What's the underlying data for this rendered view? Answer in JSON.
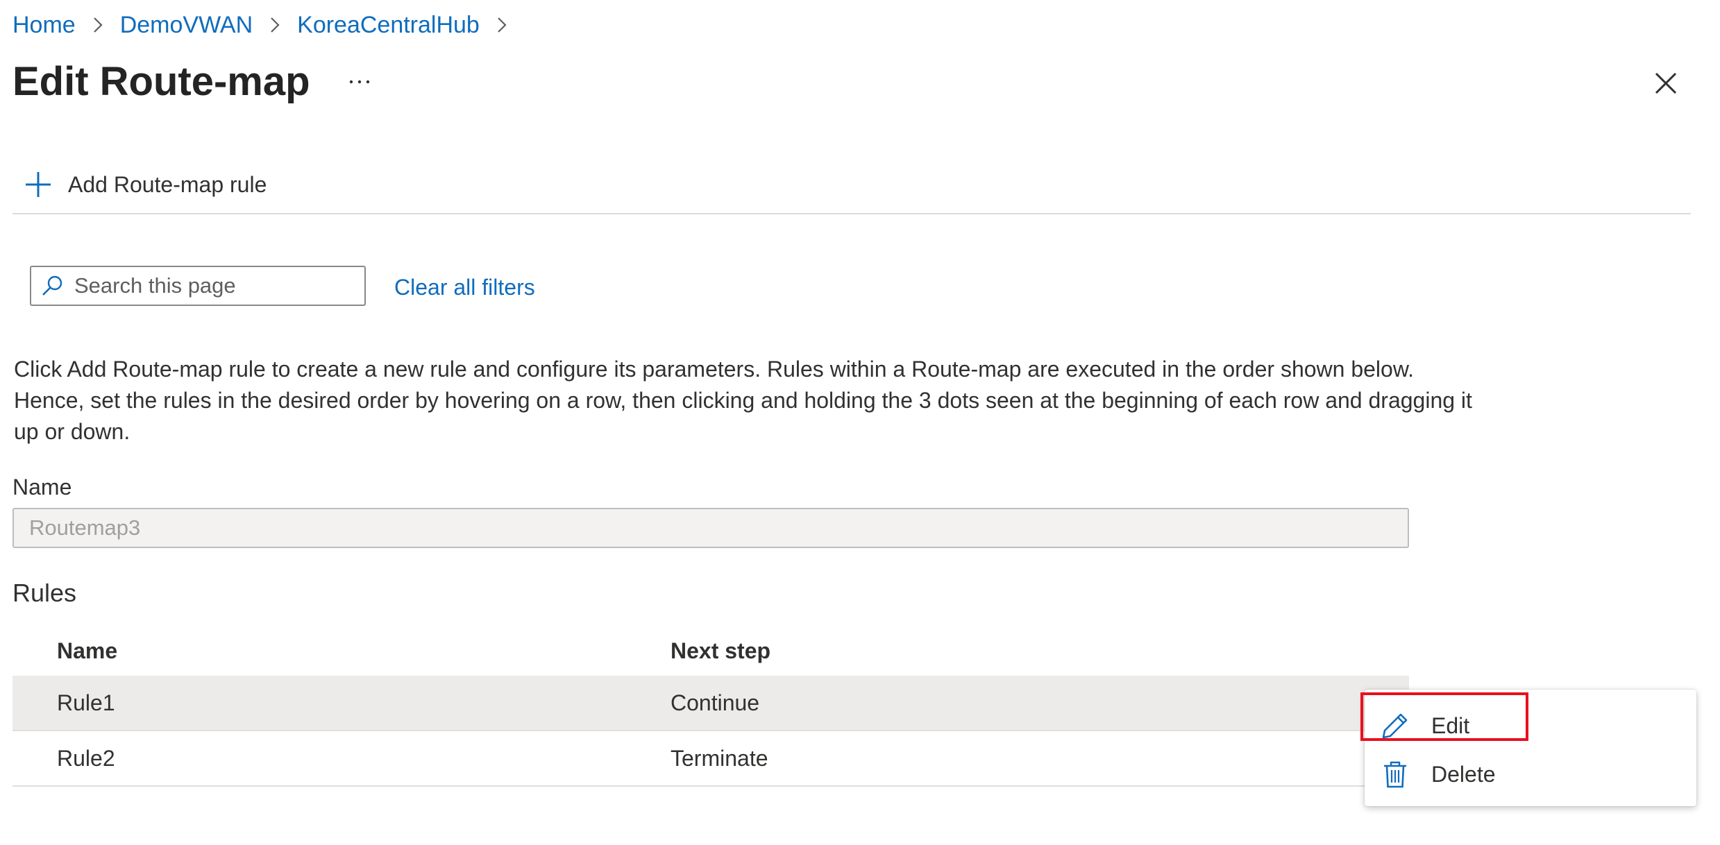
{
  "breadcrumb": {
    "items": [
      "Home",
      "DemoVWAN",
      "KoreaCentralHub"
    ]
  },
  "header": {
    "title": "Edit Route-map"
  },
  "toolbar": {
    "add_rule_label": "Add Route-map rule"
  },
  "filters": {
    "search_placeholder": "Search this page",
    "clear_label": "Clear all filters"
  },
  "description": "Click Add Route-map rule to create a new rule and configure its parameters. Rules within a Route-map are executed in the order shown below. Hence, set the rules in the desired order by hovering on a row, then clicking and holding the 3 dots seen at the beginning of each row and dragging it up or down.",
  "form": {
    "name_label": "Name",
    "name_value": "Routemap3"
  },
  "rules": {
    "title": "Rules",
    "columns": [
      "Name",
      "Next step"
    ],
    "rows": [
      {
        "name": "Rule1",
        "next_step": "Continue"
      },
      {
        "name": "Rule2",
        "next_step": "Terminate"
      }
    ]
  },
  "context_menu": {
    "items": [
      {
        "label": "Edit",
        "icon": "pencil-icon"
      },
      {
        "label": "Delete",
        "icon": "trash-icon"
      }
    ]
  },
  "colors": {
    "link": "#0f6cbd",
    "highlight": "#e8101e",
    "selected_row": "#edebe9"
  }
}
